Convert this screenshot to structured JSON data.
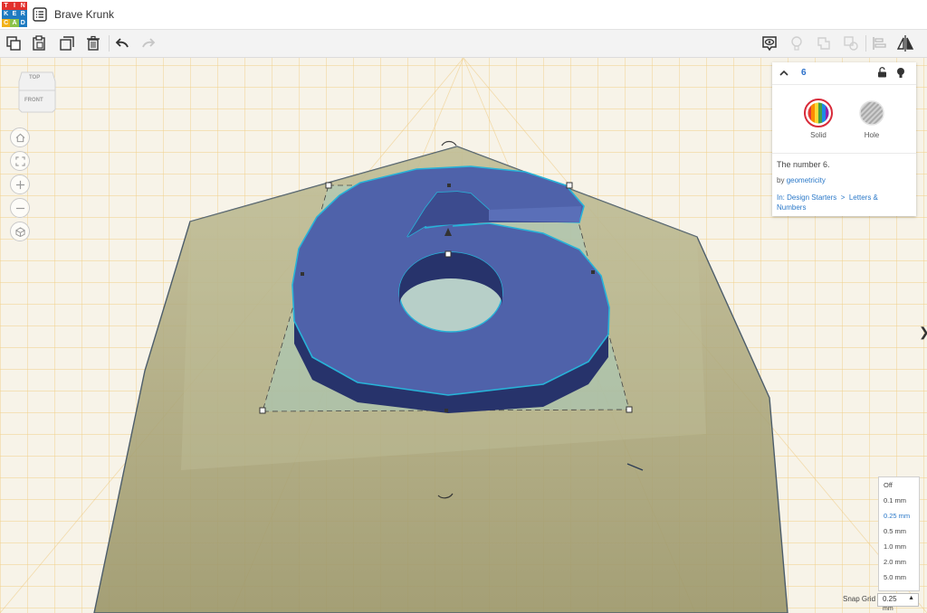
{
  "app": {
    "logo_letters": [
      "T",
      "I",
      "N",
      "K",
      "E",
      "R",
      "C",
      "A",
      "D"
    ],
    "logo_colors": [
      "#e2312d",
      "#e2312d",
      "#e2312d",
      "#1f7bc1",
      "#1f7bc1",
      "#1f7bc1",
      "#f2b21b",
      "#8bc34a",
      "#1f7bc1"
    ],
    "project_title": "Brave Krunk"
  },
  "toolbar": {
    "left_icons": [
      "copy-icon",
      "paste-icon",
      "duplicate-icon",
      "trash-icon",
      "undo-icon",
      "redo-icon"
    ],
    "right_icons": [
      "show-hide-icon",
      "light-bulb-icon",
      "group-icon",
      "ungroup-icon",
      "align-icon",
      "mirror-icon"
    ]
  },
  "viewcube": {
    "top_label": "TOP",
    "front_label": "FRONT"
  },
  "nav": [
    "home-icon",
    "fit-view-icon",
    "zoom-in-icon",
    "zoom-out-icon",
    "perspective-icon"
  ],
  "inspector": {
    "shape_name": "6",
    "solid_label": "Solid",
    "hole_label": "Hole",
    "description": "The number 6.",
    "by_prefix": "by",
    "author": "geometricity",
    "in_prefix": "In:",
    "category": "Design Starters",
    "separator": ">",
    "subcategory": "Letters &",
    "subcategory_line2": "Numbers"
  },
  "snap_grid": {
    "label": "Snap Grid",
    "value": "0.25",
    "unit": "mm",
    "options": [
      "Off",
      "0.1 mm",
      "0.25 mm",
      "0.5 mm",
      "1.0 mm",
      "2.0 mm",
      "5.0 mm"
    ],
    "selected_index": 2
  },
  "colors": {
    "accent": "#2a78c8",
    "shape_blue": "#4f62aa",
    "grid_line": "#f0c870",
    "selection": "#27b3d8"
  }
}
